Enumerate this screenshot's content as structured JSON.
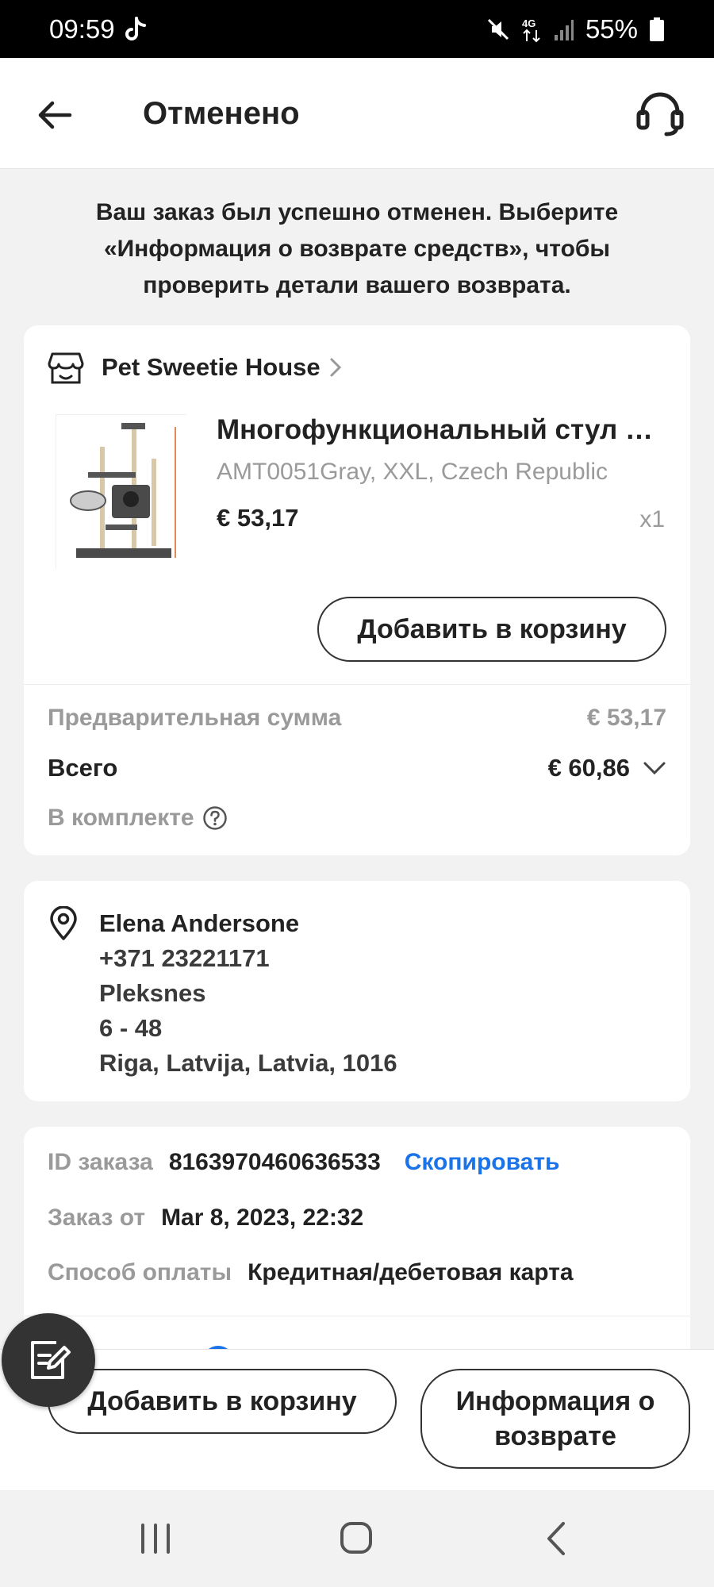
{
  "status_bar": {
    "time": "09:59",
    "battery": "55%",
    "network": "4G"
  },
  "header": {
    "title": "Отменено"
  },
  "notice": "Ваш заказ был успешно отменен. Выберите «Информация о возврате средств», чтобы проверить детали вашего возврата.",
  "order": {
    "store_name": "Pet Sweetie House",
    "product": {
      "title": "Многофункциональный стул для кошек",
      "variant": "AMT0051Gray, XXL, Czech Republic",
      "price": "€ 53,17",
      "quantity": "x1"
    },
    "add_to_cart_label": "Добавить в корзину",
    "subtotal_label": "Предварительная сумма",
    "subtotal_value": "€ 53,17",
    "total_label": "Всего",
    "total_value": "€ 60,86",
    "included_label": "В комплекте"
  },
  "address": {
    "name": "Elena Andersone",
    "phone": "+371 23221171",
    "street": "Pleksnes",
    "apartment": "6 - 48",
    "city": "Riga, Latvija, Latvia, 1016"
  },
  "details": {
    "order_id_label": "ID заказа",
    "order_id": "8163970460636533",
    "copy_label": "Скопировать",
    "date_label": "Заказ от",
    "date": "Mar 8, 2023, 22:32",
    "payment_label": "Способ оплаты",
    "payment": "Кредитная/дебетовая карта"
  },
  "actions": {
    "add_to_cart_label": "Добавить в корзину",
    "refund_info_label": "Информация о возврате"
  },
  "icons": {
    "back": "arrow-left-icon",
    "support": "headset-icon",
    "store": "store-icon",
    "location": "location-pin-icon",
    "help": "question-circle-icon",
    "feedback": "edit-note-icon"
  },
  "colors": {
    "link_blue": "#1a73e8",
    "muted_text": "#9a9a9a"
  }
}
